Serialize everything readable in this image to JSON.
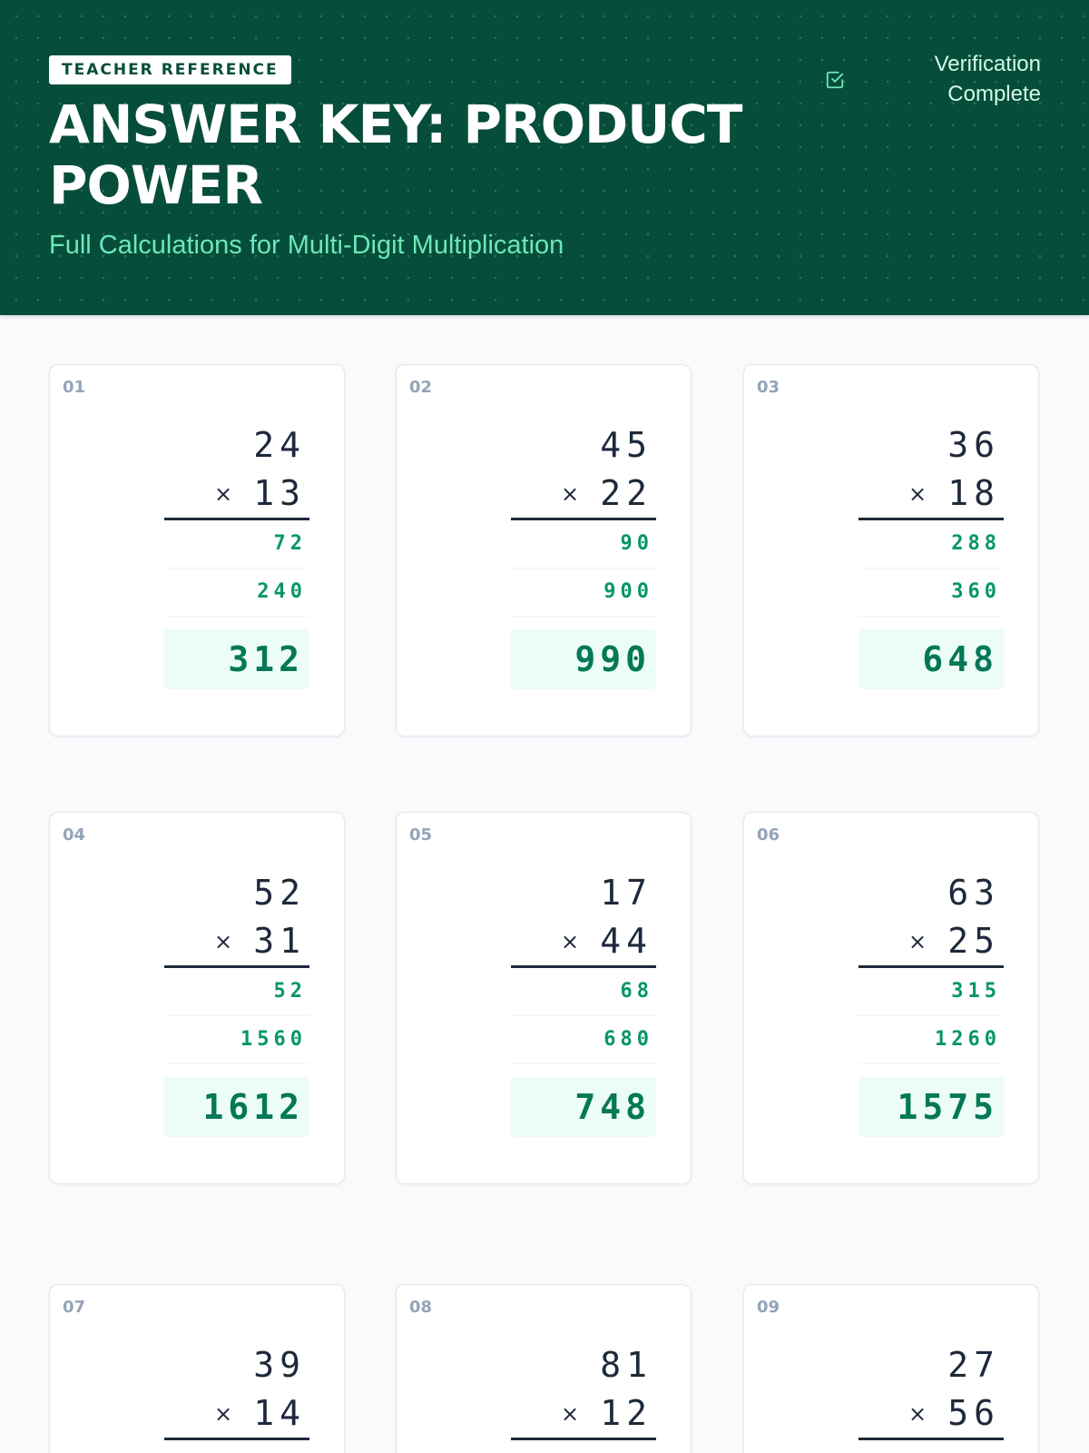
{
  "header": {
    "badge": "TEACHER REFERENCE",
    "title": "ANSWER KEY: PRODUCT POWER",
    "subtitle": "Full Calculations for Multi-Digit Multiplication",
    "status": "Verification Complete",
    "status_icon": "check-square-icon"
  },
  "colors": {
    "header_bg": "#064e3b",
    "accent": "#6ee7b7",
    "partial": "#059669",
    "result": "#047857",
    "result_bg": "#ecfdf5"
  },
  "operator": "×",
  "problems": [
    {
      "number": "01",
      "top": "24",
      "bottom": "13",
      "partials": [
        "72",
        "240"
      ],
      "result": "312"
    },
    {
      "number": "02",
      "top": "45",
      "bottom": "22",
      "partials": [
        "90",
        "900"
      ],
      "result": "990"
    },
    {
      "number": "03",
      "top": "36",
      "bottom": "18",
      "partials": [
        "288",
        "360"
      ],
      "result": "648"
    },
    {
      "number": "04",
      "top": "52",
      "bottom": "31",
      "partials": [
        "52",
        "1560"
      ],
      "result": "1612"
    },
    {
      "number": "05",
      "top": "17",
      "bottom": "44",
      "partials": [
        "68",
        "680"
      ],
      "result": "748"
    },
    {
      "number": "06",
      "top": "63",
      "bottom": "25",
      "partials": [
        "315",
        "1260"
      ],
      "result": "1575"
    },
    {
      "number": "07",
      "top": "39",
      "bottom": "14"
    },
    {
      "number": "08",
      "top": "81",
      "bottom": "12"
    },
    {
      "number": "09",
      "top": "27",
      "bottom": "56"
    }
  ]
}
